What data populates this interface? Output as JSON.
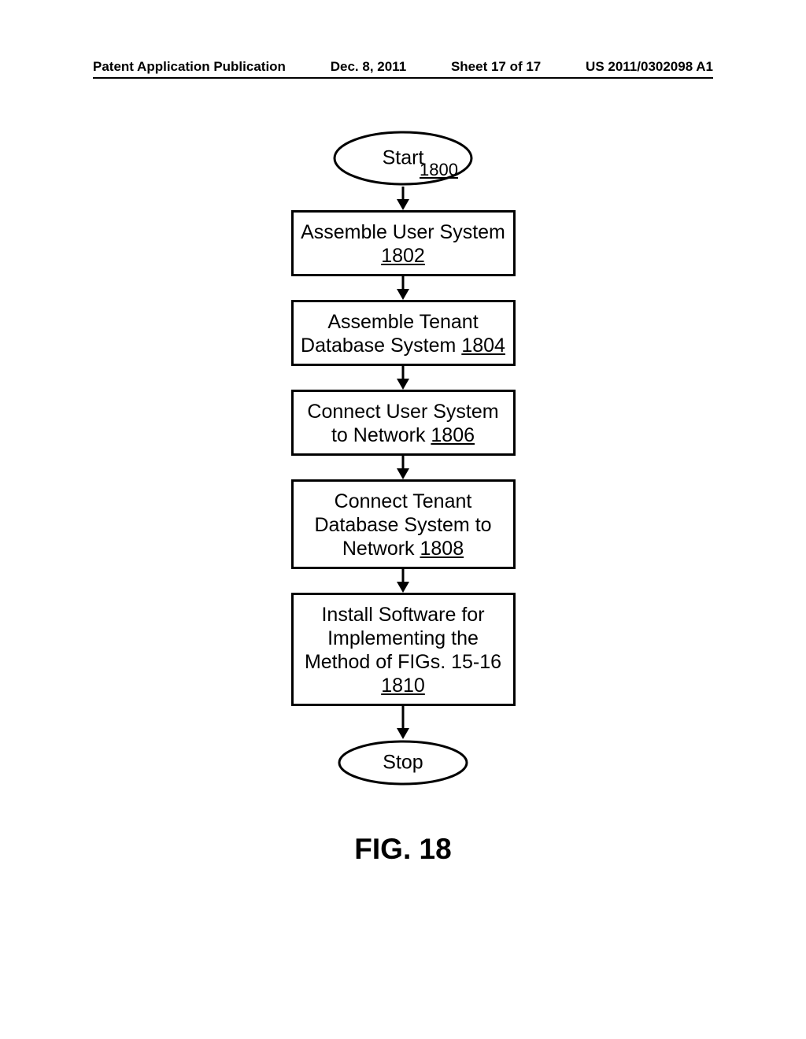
{
  "header": {
    "pub_type": "Patent Application Publication",
    "date": "Dec. 8, 2011",
    "sheet": "Sheet 17 of 17",
    "pub_number": "US 2011/0302098 A1"
  },
  "flowchart": {
    "start": {
      "label": "Start",
      "ref": "1800"
    },
    "steps": [
      {
        "text": "Assemble User System",
        "ref": "1802"
      },
      {
        "text": "Assemble Tenant Database System",
        "ref": "1804"
      },
      {
        "text": "Connect User System to Network",
        "ref": "1806"
      },
      {
        "text": "Connect Tenant Database System to Network",
        "ref": "1808"
      },
      {
        "text": "Install Software for Implementing the Method of FIGs. 15-16",
        "ref": "1810"
      }
    ],
    "stop": {
      "label": "Stop"
    }
  },
  "figure_label": "FIG. 18"
}
